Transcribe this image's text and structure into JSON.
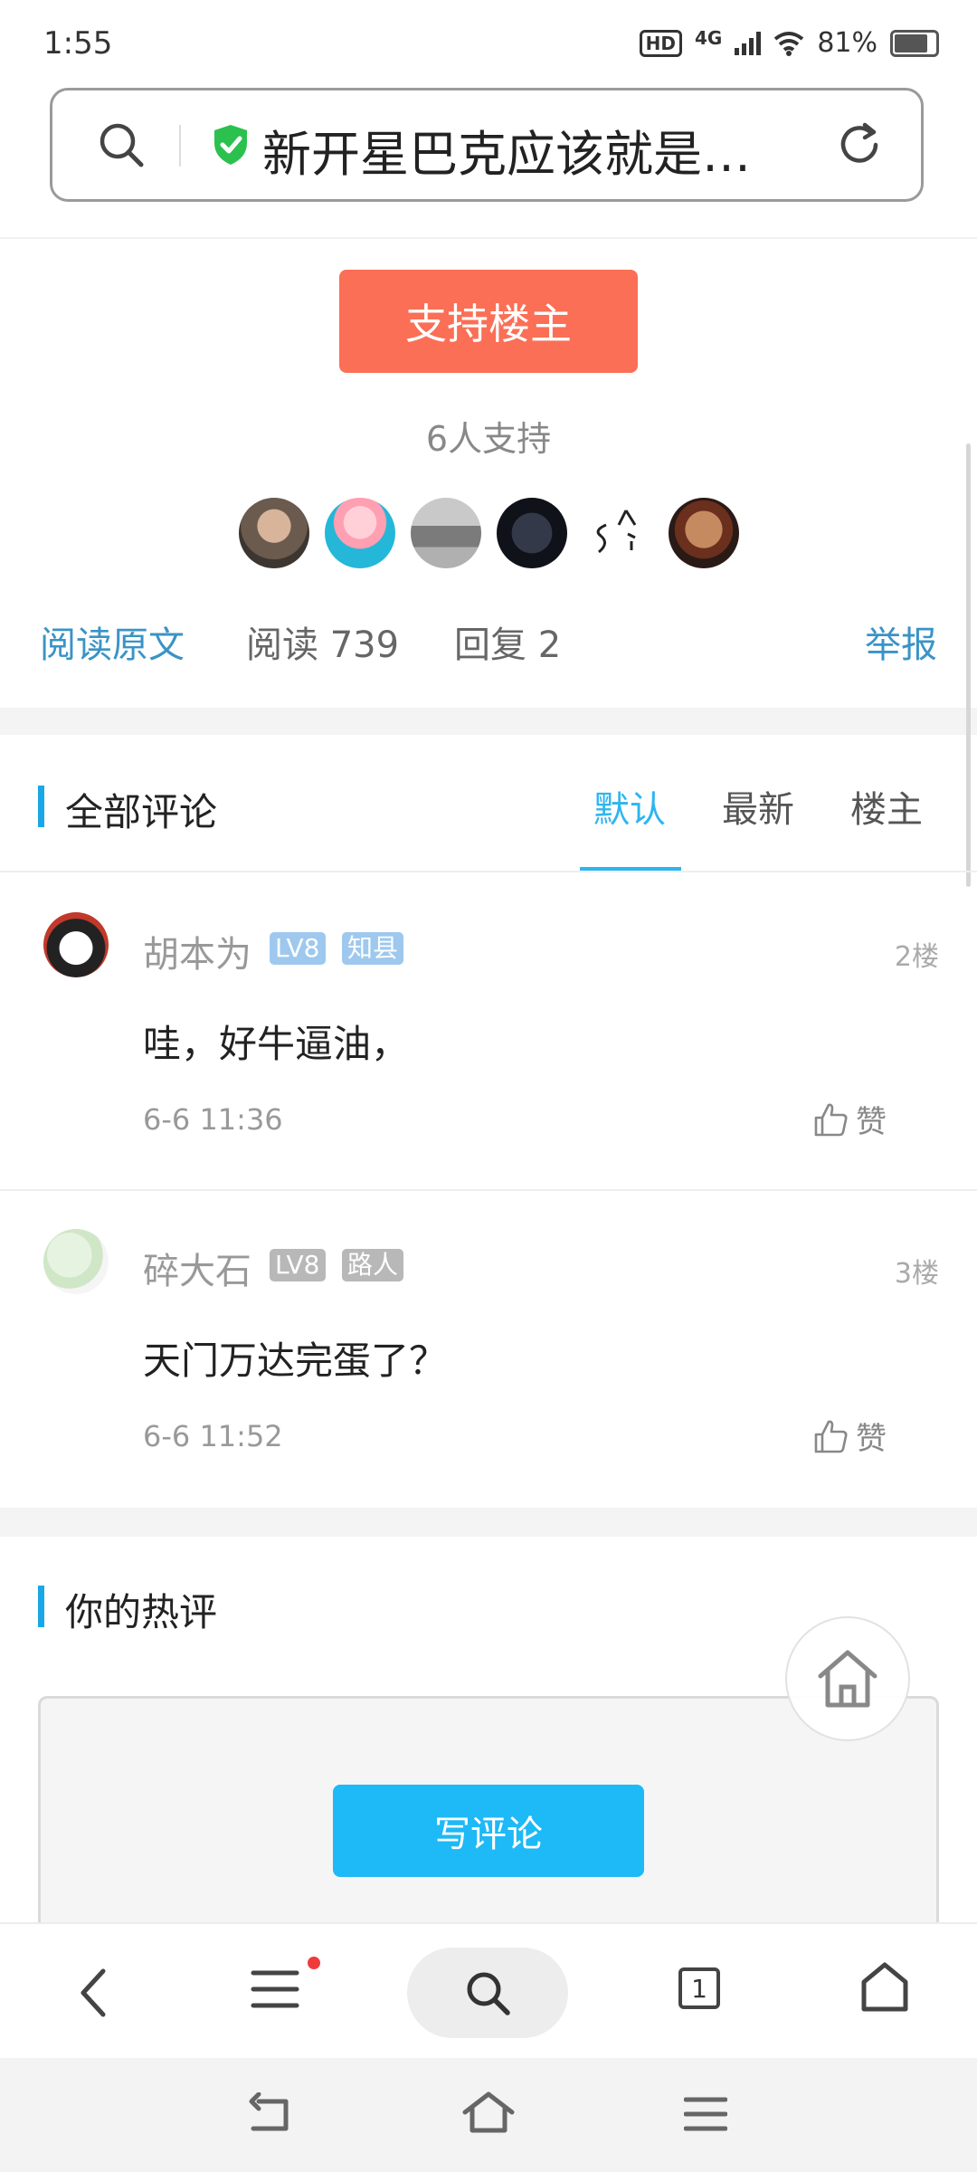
{
  "status_bar": {
    "time": "1:55",
    "hd": "HD",
    "network": "4G",
    "battery": "81%"
  },
  "search_bar": {
    "title": "新开星巴克应该就是…"
  },
  "support": {
    "button_label": "支持楼主",
    "count_text": "6人支持"
  },
  "stats": {
    "read_original": "阅读原文",
    "reads": "阅读 739",
    "replies": "回复 2",
    "report": "举报"
  },
  "comments_section": {
    "title": "全部评论",
    "tabs": [
      {
        "label": "默认",
        "active": true
      },
      {
        "label": "最新"
      },
      {
        "label": "楼主"
      }
    ]
  },
  "comments": [
    {
      "user": "胡本为",
      "level": "LV8",
      "title": "知县",
      "floor": "2楼",
      "text": "哇，好牛逼油，",
      "time": "6-6 11:36",
      "like_label": "赞"
    },
    {
      "user": "碎大石",
      "level": "LV8",
      "title": "路人",
      "floor": "3楼",
      "text": "天门万达完蛋了？",
      "time": "6-6 11:52",
      "like_label": "赞"
    }
  ],
  "hot_comment": {
    "title": "你的热评",
    "write_button": "写评论"
  },
  "bottom_bar": {
    "tab_count": "1"
  },
  "colors": {
    "accent_blue": "#1eb9f7",
    "support_orange": "#fa6f56",
    "link_blue": "#3a93c6",
    "badge_blue": "#9ec8ee",
    "badge_gray": "#b8b8b8"
  }
}
